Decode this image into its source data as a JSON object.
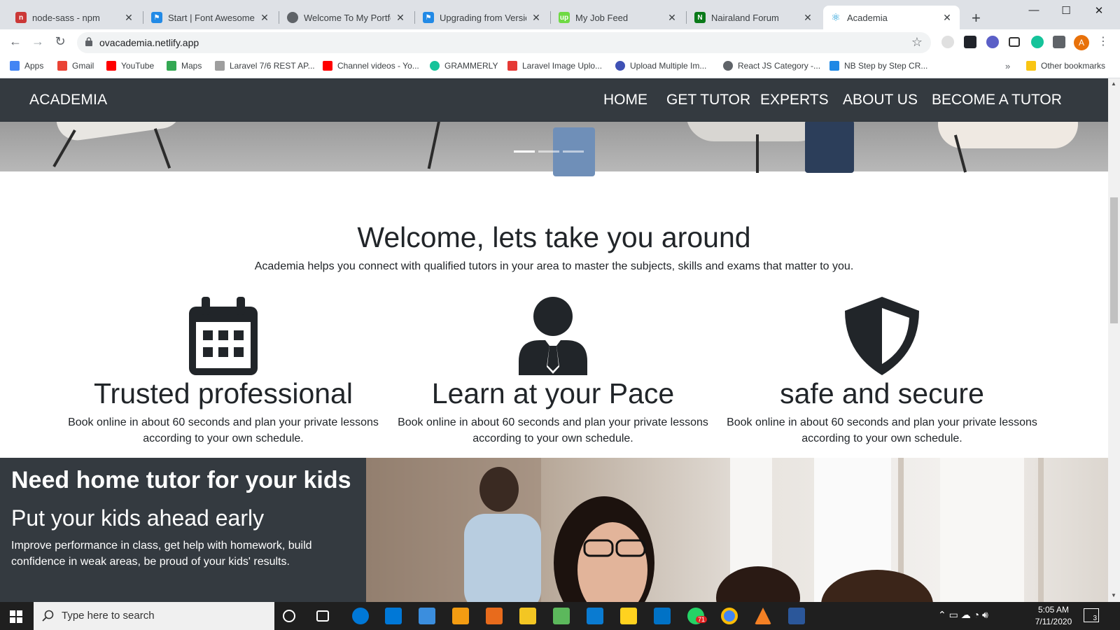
{
  "browser": {
    "tabs": [
      {
        "title": "node-sass - npm",
        "favicon_color": "#cb3837"
      },
      {
        "title": "Start | Font Awesome",
        "favicon_color": "#228ae6"
      },
      {
        "title": "Welcome To My Portfolio",
        "favicon_color": "#5f6368"
      },
      {
        "title": "Upgrading from Version",
        "favicon_color": "#228ae6"
      },
      {
        "title": "My Job Feed",
        "favicon_color": "#6fda44"
      },
      {
        "title": "Nairaland Forum",
        "favicon_color": "#0a7a1a"
      },
      {
        "title": "Academia",
        "favicon_color": "#61dafb"
      }
    ],
    "url": "ovacademia.netlify.app",
    "profile_initial": "A",
    "bookmarks": [
      {
        "label": "Apps",
        "color": "#4285f4"
      },
      {
        "label": "Gmail",
        "color": "#ea4335"
      },
      {
        "label": "YouTube",
        "color": "#ff0000"
      },
      {
        "label": "Maps",
        "color": "#34a853"
      },
      {
        "label": "Laravel 7/6 REST AP...",
        "color": "#9e9e9e"
      },
      {
        "label": "Channel videos - Yo...",
        "color": "#ff0000"
      },
      {
        "label": "GRAMMERLY",
        "color": "#15c39a"
      },
      {
        "label": "Laravel Image Uplo...",
        "color": "#e53935"
      },
      {
        "label": "Upload Multiple Im...",
        "color": "#3f51b5"
      },
      {
        "label": "React JS Category -...",
        "color": "#5f6368"
      },
      {
        "label": "NB Step by Step CR...",
        "color": "#1e88e5"
      }
    ],
    "other_bookmarks": "Other bookmarks"
  },
  "site": {
    "brand": "ACADEMIA",
    "nav": [
      "HOME",
      "GET TUTOR",
      "EXPERTS",
      "ABOUT US",
      "BECOME A TUTOR"
    ],
    "welcome_title": "Welcome, lets take you around",
    "welcome_sub": "Academia helps you connect with qualified tutors in your area to master the subjects, skills and exams that matter to you.",
    "features": [
      {
        "icon": "calendar-icon",
        "title": "Trusted professional",
        "text": "Book online in about 60 seconds and plan your private lessons according to your own schedule."
      },
      {
        "icon": "user-tie-icon",
        "title": "Learn at your Pace",
        "text": "Book online in about 60 seconds and plan your private lessons according to your own schedule."
      },
      {
        "icon": "shield-icon",
        "title": "safe and secure",
        "text": "Book online in about 60 seconds and plan your private lessons according to your own schedule."
      }
    ],
    "kids": {
      "title": "Need home tutor for your kids",
      "subtitle": "Put your kids ahead early",
      "text": "Improve performance in class, get help with homework, build confidence in weak areas, be proud of your kids' results."
    }
  },
  "taskbar": {
    "search_placeholder": "Type here to search",
    "time": "5:05 AM",
    "date": "7/11/2020",
    "whatsapp_badge": "71",
    "notification_count": "3"
  }
}
